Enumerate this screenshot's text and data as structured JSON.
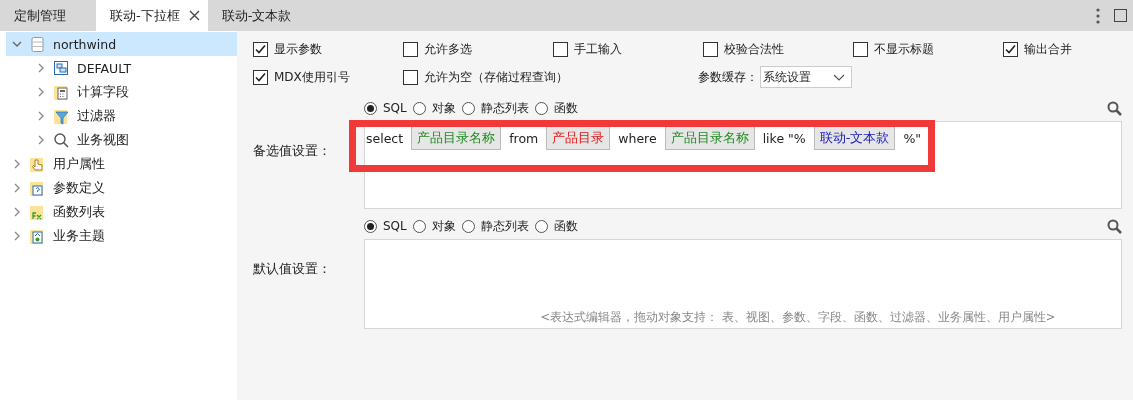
{
  "tabs": [
    {
      "label": "定制管理",
      "selected": false,
      "closable": false
    },
    {
      "label": "联动-下拉框",
      "selected": true,
      "closable": true
    },
    {
      "label": "联动-文本款",
      "selected": false,
      "closable": false
    }
  ],
  "tree": [
    {
      "label": "northwind",
      "kind": "database",
      "expanded": true,
      "selected": true,
      "children": [
        {
          "label": "DEFAULT",
          "kind": "cube",
          "expanded": false,
          "selected": false
        },
        {
          "label": "计算字段",
          "kind": "calc",
          "expanded": false,
          "selected": false
        },
        {
          "label": "过滤器",
          "kind": "filter",
          "expanded": false,
          "selected": false
        },
        {
          "label": "业务视图",
          "kind": "search",
          "expanded": false,
          "selected": false
        }
      ]
    },
    {
      "label": "用户属性",
      "kind": "user",
      "expanded": false,
      "selected": false
    },
    {
      "label": "参数定义",
      "kind": "param",
      "expanded": false,
      "selected": false
    },
    {
      "label": "函数列表",
      "kind": "function",
      "expanded": false,
      "selected": false
    },
    {
      "label": "业务主题",
      "kind": "subject",
      "expanded": false,
      "selected": false
    }
  ],
  "options_row_1": [
    {
      "label": "显示参数",
      "checked": true
    },
    {
      "label": "允许多选",
      "checked": false
    },
    {
      "label": "手工输入",
      "checked": false
    },
    {
      "label": "校验合法性",
      "checked": false
    },
    {
      "label": "不显示标题",
      "checked": false
    },
    {
      "label": "输出合并",
      "checked": true
    }
  ],
  "options_row_2": [
    {
      "label": "MDX使用引号",
      "checked": true
    },
    {
      "label": "允许为空（存储过程查询）",
      "checked": false
    }
  ],
  "cache": {
    "label": "参数缓存：",
    "value": "系统设置"
  },
  "sections": [
    {
      "label": "备选值设置：",
      "highlighted": true,
      "sources": [
        {
          "label": "SQL",
          "selected": true
        },
        {
          "label": "对象",
          "selected": false
        },
        {
          "label": "静态列表",
          "selected": false
        },
        {
          "label": "函数",
          "selected": false
        }
      ],
      "expression": [
        {
          "kind": "text",
          "text": "select"
        },
        {
          "kind": "field",
          "text": "产品目录名称"
        },
        {
          "kind": "text",
          "text": "from"
        },
        {
          "kind": "table",
          "text": "产品目录"
        },
        {
          "kind": "text",
          "text": "where"
        },
        {
          "kind": "field",
          "text": "产品目录名称"
        },
        {
          "kind": "text",
          "text": "like \"%"
        },
        {
          "kind": "param",
          "text": "联动-文本款"
        },
        {
          "kind": "text",
          "text": "%\""
        }
      ]
    },
    {
      "label": "默认值设置：",
      "highlighted": false,
      "sources": [
        {
          "label": "SQL",
          "selected": true
        },
        {
          "label": "对象",
          "selected": false
        },
        {
          "label": "静态列表",
          "selected": false
        },
        {
          "label": "函数",
          "selected": false
        }
      ],
      "placeholder": "<表达式编辑器，拖动对象支持： 表、视图、参数、字段、函数、过滤器、业务属性、用户属性>"
    }
  ]
}
